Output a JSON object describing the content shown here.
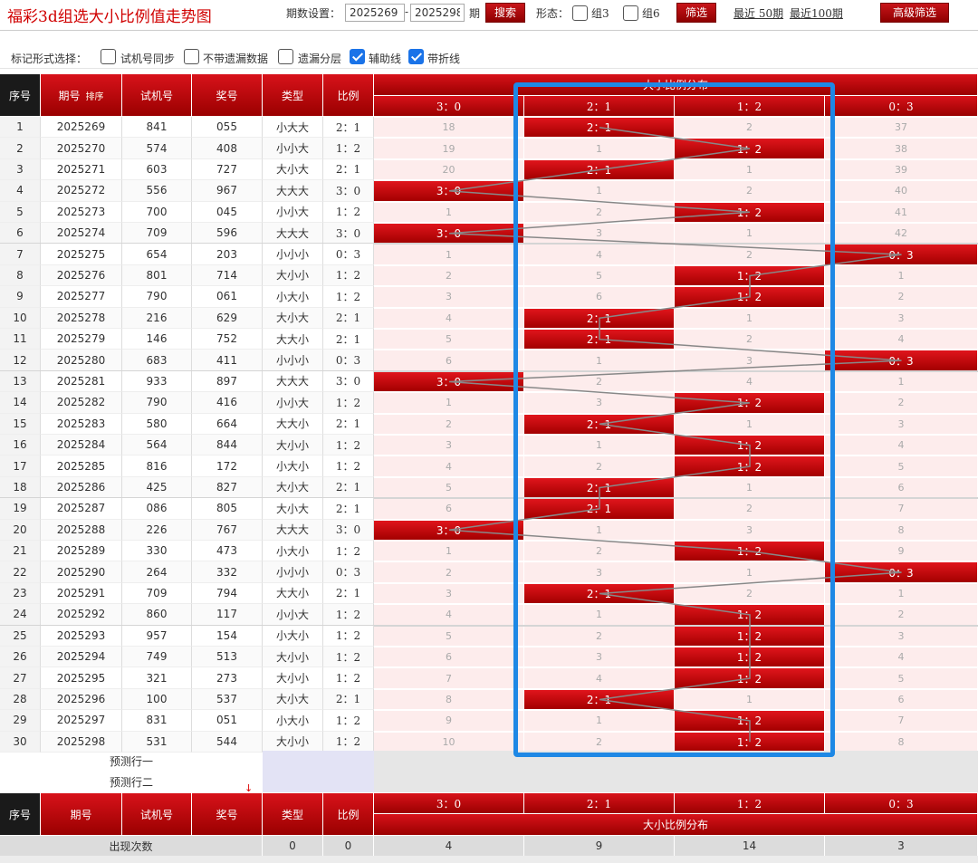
{
  "app_title": "福彩3d组选大小比例值走势图",
  "controls": {
    "period_label": "期数设置：",
    "from_value": "2025269",
    "to_value": "2025298",
    "dash": "-",
    "unit_label": "期",
    "search_label": "搜索",
    "shape_label": "形态：",
    "group3_label": "组3",
    "group6_label": "组6",
    "filter_label": "筛选",
    "recent50": "最近 50期",
    "recent100": "最近100期",
    "advanced_label": "高级筛选"
  },
  "marks": {
    "label": "标记形式选择：",
    "options": [
      {
        "label": "试机号同步",
        "checked": false
      },
      {
        "label": "不带遗漏数据",
        "checked": false
      },
      {
        "label": "遗漏分层",
        "checked": false
      },
      {
        "label": "辅助线",
        "checked": true
      },
      {
        "label": "带折线",
        "checked": true
      }
    ]
  },
  "header": {
    "seq": "序号",
    "period": "期号",
    "sort": "排序",
    "test_no": "试机号",
    "prize": "奖号",
    "type": "类型",
    "ratio": "比例",
    "dist_title": "大小比例分布",
    "dist_cols": [
      "3：0",
      "2：1",
      "1：2",
      "0：3"
    ]
  },
  "rows": [
    {
      "seq": "1",
      "period": "2025269",
      "test": "841",
      "prize": "055",
      "type": "小大大",
      "ratio": "2：1",
      "dist": [
        "18",
        "2：1",
        "2",
        "37"
      ],
      "hit": 1
    },
    {
      "seq": "2",
      "period": "2025270",
      "test": "574",
      "prize": "408",
      "type": "小小大",
      "ratio": "1：2",
      "dist": [
        "19",
        "1",
        "1：2",
        "38"
      ],
      "hit": 2
    },
    {
      "seq": "3",
      "period": "2025271",
      "test": "603",
      "prize": "727",
      "type": "大小大",
      "ratio": "2：1",
      "dist": [
        "20",
        "2：1",
        "1",
        "39"
      ],
      "hit": 1
    },
    {
      "seq": "4",
      "period": "2025272",
      "test": "556",
      "prize": "967",
      "type": "大大大",
      "ratio": "3：0",
      "dist": [
        "3：0",
        "1",
        "2",
        "40"
      ],
      "hit": 0
    },
    {
      "seq": "5",
      "period": "2025273",
      "test": "700",
      "prize": "045",
      "type": "小小大",
      "ratio": "1：2",
      "dist": [
        "1",
        "2",
        "1：2",
        "41"
      ],
      "hit": 2
    },
    {
      "seq": "6",
      "period": "2025274",
      "test": "709",
      "prize": "596",
      "type": "大大大",
      "ratio": "3：0",
      "dist": [
        "3：0",
        "3",
        "1",
        "42"
      ],
      "hit": 0
    },
    {
      "seq": "7",
      "period": "2025275",
      "test": "654",
      "prize": "203",
      "type": "小小小",
      "ratio": "0：3",
      "dist": [
        "1",
        "4",
        "2",
        "0：3"
      ],
      "hit": 3
    },
    {
      "seq": "8",
      "period": "2025276",
      "test": "801",
      "prize": "714",
      "type": "大小小",
      "ratio": "1：2",
      "dist": [
        "2",
        "5",
        "1：2",
        "1"
      ],
      "hit": 2
    },
    {
      "seq": "9",
      "period": "2025277",
      "test": "790",
      "prize": "061",
      "type": "小大小",
      "ratio": "1：2",
      "dist": [
        "3",
        "6",
        "1：2",
        "2"
      ],
      "hit": 2
    },
    {
      "seq": "10",
      "period": "2025278",
      "test": "216",
      "prize": "629",
      "type": "大小大",
      "ratio": "2：1",
      "dist": [
        "4",
        "2：1",
        "1",
        "3"
      ],
      "hit": 1
    },
    {
      "seq": "11",
      "period": "2025279",
      "test": "146",
      "prize": "752",
      "type": "大大小",
      "ratio": "2：1",
      "dist": [
        "5",
        "2：1",
        "2",
        "4"
      ],
      "hit": 1
    },
    {
      "seq": "12",
      "period": "2025280",
      "test": "683",
      "prize": "411",
      "type": "小小小",
      "ratio": "0：3",
      "dist": [
        "6",
        "1",
        "3",
        "0：3"
      ],
      "hit": 3
    },
    {
      "seq": "13",
      "period": "2025281",
      "test": "933",
      "prize": "897",
      "type": "大大大",
      "ratio": "3：0",
      "dist": [
        "3：0",
        "2",
        "4",
        "1"
      ],
      "hit": 0
    },
    {
      "seq": "14",
      "period": "2025282",
      "test": "790",
      "prize": "416",
      "type": "小小大",
      "ratio": "1：2",
      "dist": [
        "1",
        "3",
        "1：2",
        "2"
      ],
      "hit": 2
    },
    {
      "seq": "15",
      "period": "2025283",
      "test": "580",
      "prize": "664",
      "type": "大大小",
      "ratio": "2：1",
      "dist": [
        "2",
        "2：1",
        "1",
        "3"
      ],
      "hit": 1
    },
    {
      "seq": "16",
      "period": "2025284",
      "test": "564",
      "prize": "844",
      "type": "大小小",
      "ratio": "1：2",
      "dist": [
        "3",
        "1",
        "1：2",
        "4"
      ],
      "hit": 2
    },
    {
      "seq": "17",
      "period": "2025285",
      "test": "816",
      "prize": "172",
      "type": "小大小",
      "ratio": "1：2",
      "dist": [
        "4",
        "2",
        "1：2",
        "5"
      ],
      "hit": 2
    },
    {
      "seq": "18",
      "period": "2025286",
      "test": "425",
      "prize": "827",
      "type": "大小大",
      "ratio": "2：1",
      "dist": [
        "5",
        "2：1",
        "1",
        "6"
      ],
      "hit": 1
    },
    {
      "seq": "19",
      "period": "2025287",
      "test": "086",
      "prize": "805",
      "type": "大小大",
      "ratio": "2：1",
      "dist": [
        "6",
        "2：1",
        "2",
        "7"
      ],
      "hit": 1
    },
    {
      "seq": "20",
      "period": "2025288",
      "test": "226",
      "prize": "767",
      "type": "大大大",
      "ratio": "3：0",
      "dist": [
        "3：0",
        "1",
        "3",
        "8"
      ],
      "hit": 0
    },
    {
      "seq": "21",
      "period": "2025289",
      "test": "330",
      "prize": "473",
      "type": "小大小",
      "ratio": "1：2",
      "dist": [
        "1",
        "2",
        "1：2",
        "9"
      ],
      "hit": 2
    },
    {
      "seq": "22",
      "period": "2025290",
      "test": "264",
      "prize": "332",
      "type": "小小小",
      "ratio": "0：3",
      "dist": [
        "2",
        "3",
        "1",
        "0：3"
      ],
      "hit": 3
    },
    {
      "seq": "23",
      "period": "2025291",
      "test": "709",
      "prize": "794",
      "type": "大大小",
      "ratio": "2：1",
      "dist": [
        "3",
        "2：1",
        "2",
        "1"
      ],
      "hit": 1
    },
    {
      "seq": "24",
      "period": "2025292",
      "test": "860",
      "prize": "117",
      "type": "小小大",
      "ratio": "1：2",
      "dist": [
        "4",
        "1",
        "1：2",
        "2"
      ],
      "hit": 2
    },
    {
      "seq": "25",
      "period": "2025293",
      "test": "957",
      "prize": "154",
      "type": "小大小",
      "ratio": "1：2",
      "dist": [
        "5",
        "2",
        "1：2",
        "3"
      ],
      "hit": 2
    },
    {
      "seq": "26",
      "period": "2025294",
      "test": "749",
      "prize": "513",
      "type": "大小小",
      "ratio": "1：2",
      "dist": [
        "6",
        "3",
        "1：2",
        "4"
      ],
      "hit": 2
    },
    {
      "seq": "27",
      "period": "2025295",
      "test": "321",
      "prize": "273",
      "type": "大小小",
      "ratio": "1：2",
      "dist": [
        "7",
        "4",
        "1：2",
        "5"
      ],
      "hit": 2
    },
    {
      "seq": "28",
      "period": "2025296",
      "test": "100",
      "prize": "537",
      "type": "大小大",
      "ratio": "2：1",
      "dist": [
        "8",
        "2：1",
        "1",
        "6"
      ],
      "hit": 1
    },
    {
      "seq": "29",
      "period": "2025297",
      "test": "831",
      "prize": "051",
      "type": "小大小",
      "ratio": "1：2",
      "dist": [
        "9",
        "1",
        "1：2",
        "7"
      ],
      "hit": 2
    },
    {
      "seq": "30",
      "period": "2025298",
      "test": "531",
      "prize": "544",
      "type": "大小小",
      "ratio": "1：2",
      "dist": [
        "10",
        "2",
        "1：2",
        "8"
      ],
      "hit": 2
    }
  ],
  "predict": {
    "row1": "预测行一",
    "row2": "预测行二"
  },
  "footer": {
    "count_label": "出现次数",
    "count_type": "0",
    "count_ratio": "0",
    "counts": [
      "4",
      "9",
      "14",
      "3"
    ]
  },
  "colors": {
    "brand_red": "#c8151a",
    "highlight_blue": "#1e88e5",
    "miss_bg": "#fdecec"
  }
}
